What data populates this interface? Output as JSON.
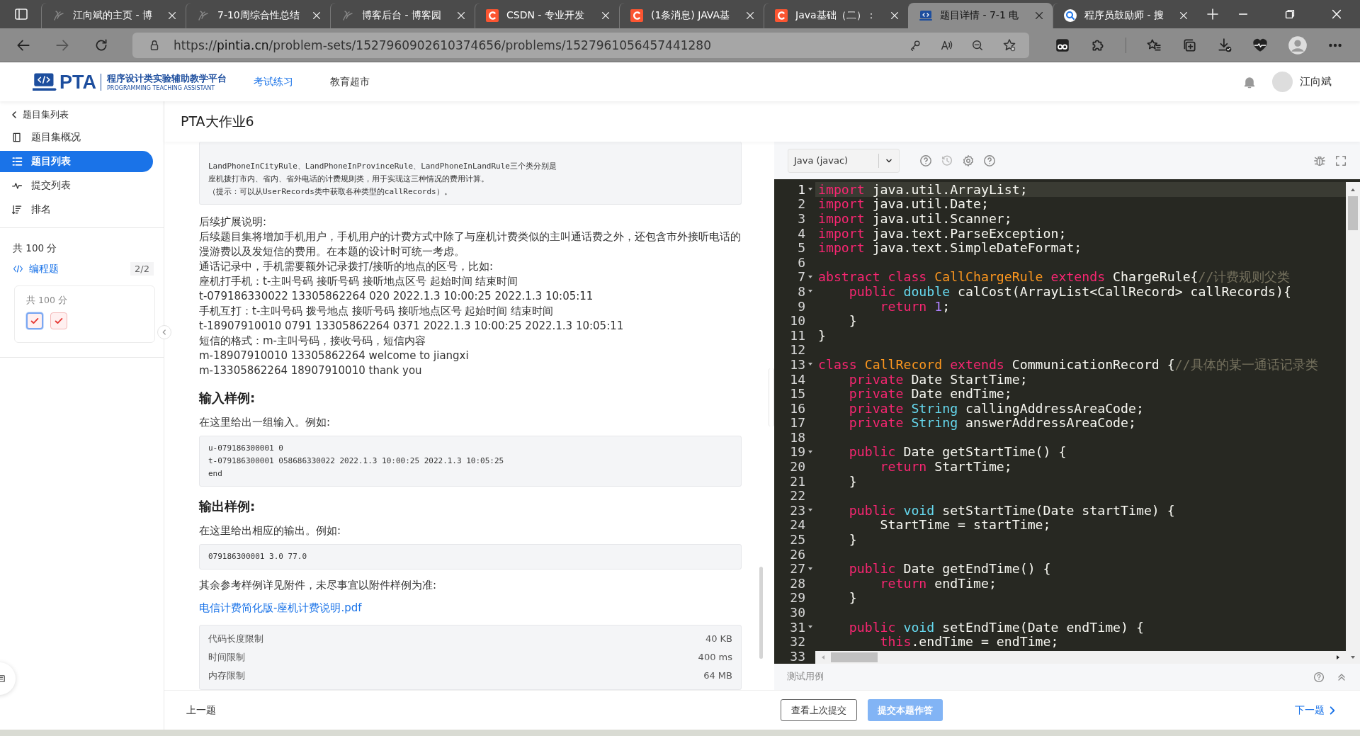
{
  "browser": {
    "tabs": [
      {
        "title": "江向斌的主页 - 博",
        "kind": "blog",
        "selected": false
      },
      {
        "title": "7-10周综合性总结",
        "kind": "blog",
        "selected": false
      },
      {
        "title": "博客后台 - 博客园",
        "kind": "blog",
        "selected": false
      },
      {
        "title": "CSDN - 专业开发",
        "kind": "csdn",
        "selected": false
      },
      {
        "title": "(1条消息) JAVA基",
        "kind": "csdn",
        "selected": false
      },
      {
        "title": "Java基础（二）：",
        "kind": "csdn",
        "selected": false
      },
      {
        "title": "题目详情 - 7-1 电",
        "kind": "pta",
        "selected": true
      },
      {
        "title": "程序员鼓励师 - 搜",
        "kind": "search",
        "selected": false
      }
    ],
    "url_prefix": "https://",
    "url_domain": "pintia.cn",
    "url_path": "/problem-sets/1527960902610374656/problems/1527961056457441280"
  },
  "header": {
    "logo": "PTA",
    "platform": "程序设计类实验辅助教学平台",
    "platform_en": "PROGRAMMING TEACHING ASSISTANT",
    "nav": [
      {
        "label": "考试练习",
        "selected": true
      },
      {
        "label": "教育超市",
        "selected": false
      }
    ],
    "user": "江向斌"
  },
  "sidebar": {
    "back": "题目集列表",
    "items": [
      {
        "label": "题目集概况",
        "kind": "overview",
        "selected": false
      },
      {
        "label": "题目列表",
        "kind": "list",
        "selected": true
      },
      {
        "label": "提交列表",
        "kind": "submissions",
        "selected": false
      },
      {
        "label": "排名",
        "kind": "ranking",
        "selected": false
      }
    ],
    "total": "共 100 分",
    "section": {
      "label": "编程题",
      "count": "2/2"
    },
    "card": {
      "total": "共 100 分",
      "problems": [
        {
          "selected": true,
          "solved": true
        },
        {
          "selected": false,
          "solved": true
        }
      ]
    }
  },
  "problem": {
    "title": "PTA大作业6",
    "blocks": [
      {
        "kind": "code",
        "lines": [
          "LandPhoneInCityRule、LandPhoneInProvinceRule、LandPhoneInLandRule三个类分别是",
          "座机拨打市内、省内、省外电话的计费规则类，用于实现这三种情况的费用计算。",
          "（提示：可以从UserRecords类中获取各种类型的callRecords）。"
        ]
      },
      {
        "kind": "text",
        "lines": [
          "后续扩展说明:",
          "后续题目集将增加手机用户，手机用户的计费方式中除了与座机计费类似的主叫通话费之外，还包含市外接听电话的漫游费以及发短信的费用。在本题的设计时可统一考虑。",
          "通话记录中，手机需要额外记录拨打/接听的地点的区号，比如:",
          "座机打手机：t-主叫号码 接听号码 接听地点区号 起始时间 结束时间",
          "t-079186330022 13305862264 020 2022.1.3 10:00:25 2022.1.3 10:05:11",
          "手机互打：t-主叫号码 拨号地点 接听号码 接听地点区号 起始时间 结束时间",
          "t-18907910010 0791 13305862264 0371 2022.1.3 10:00:25 2022.1.3 10:05:11",
          "短信的格式：m-主叫号码，接收号码，短信内容",
          "m-18907910010 13305862264 welcome to jiangxi",
          "m-13305862264 18907910010 thank you"
        ]
      },
      {
        "kind": "heading",
        "text": "输入样例:"
      },
      {
        "kind": "text",
        "lines": [
          "在这里给出一组输入。例如:"
        ]
      },
      {
        "kind": "code",
        "lines": [
          "u-079186300001 0",
          "t-079186300001 058686330022 2022.1.3 10:00:25 2022.1.3 10:05:25",
          "end"
        ]
      },
      {
        "kind": "heading",
        "text": "输出样例:"
      },
      {
        "kind": "text",
        "lines": [
          "在这里给出相应的输出。例如:"
        ]
      },
      {
        "kind": "code",
        "lines": [
          "079186300001 3.0 77.0"
        ]
      },
      {
        "kind": "text",
        "lines": [
          "其余参考样例详见附件，未尽事宜以附件样例为准:"
        ]
      },
      {
        "kind": "link",
        "text": "电信计费简化版-座机计费说明.pdf"
      },
      {
        "kind": "limits",
        "rows": [
          {
            "label": "代码长度限制",
            "value": "40 KB"
          },
          {
            "label": "时间限制",
            "value": "400 ms"
          },
          {
            "label": "内存限制",
            "value": "64 MB"
          }
        ]
      }
    ]
  },
  "editor": {
    "language": "Java (javac)",
    "lines": [
      {
        "n": "1",
        "fold": true,
        "active": true,
        "tokens": [
          {
            "kind": "kw",
            "text": "import"
          },
          {
            "kind": "pl",
            "text": " java.util.ArrayList;"
          }
        ]
      },
      {
        "n": "2",
        "fold": false,
        "active": false,
        "tokens": [
          {
            "kind": "kw",
            "text": "import"
          },
          {
            "kind": "pl",
            "text": " java.util.Date;"
          }
        ]
      },
      {
        "n": "3",
        "fold": false,
        "active": false,
        "tokens": [
          {
            "kind": "kw",
            "text": "import"
          },
          {
            "kind": "pl",
            "text": " java.util.Scanner;"
          }
        ]
      },
      {
        "n": "4",
        "fold": false,
        "active": false,
        "tokens": [
          {
            "kind": "kw",
            "text": "import"
          },
          {
            "kind": "pl",
            "text": " java.text.ParseException;"
          }
        ]
      },
      {
        "n": "5",
        "fold": false,
        "active": false,
        "tokens": [
          {
            "kind": "kw",
            "text": "import"
          },
          {
            "kind": "pl",
            "text": " java.text.SimpleDateFormat;"
          }
        ]
      },
      {
        "n": "6",
        "fold": false,
        "active": false
      },
      {
        "n": "7",
        "fold": true,
        "active": false,
        "tokens": [
          {
            "kind": "kw",
            "text": "abstract"
          },
          {
            "kind": "kw",
            "text": " class"
          },
          {
            "kind": "cls",
            "text": " CallChargeRule"
          },
          {
            "kind": "kw",
            "text": " extends"
          },
          {
            "kind": "pl",
            "text": " ChargeRule{"
          },
          {
            "kind": "cm",
            "text": "//计费规则父类"
          }
        ]
      },
      {
        "n": "8",
        "fold": true,
        "active": false,
        "tokens": [
          {
            "kind": "kw",
            "text": "    public"
          },
          {
            "kind": "ty",
            "text": " double"
          },
          {
            "kind": "pl",
            "text": " calCost(ArrayList<CallRecord> callRecords){"
          }
        ]
      },
      {
        "n": "9",
        "fold": false,
        "active": false,
        "tokens": [
          {
            "kind": "kw",
            "text": "        return"
          },
          {
            "kind": "num",
            "text": " 1"
          },
          {
            "kind": "pl",
            "text": ";"
          }
        ]
      },
      {
        "n": "10",
        "fold": false,
        "active": false,
        "tokens": [
          {
            "kind": "pl",
            "text": "    }"
          }
        ]
      },
      {
        "n": "11",
        "fold": false,
        "active": false,
        "tokens": [
          {
            "kind": "pl",
            "text": "}"
          }
        ]
      },
      {
        "n": "12",
        "fold": false,
        "active": false
      },
      {
        "n": "13",
        "fold": true,
        "active": false,
        "tokens": [
          {
            "kind": "kw",
            "text": "class"
          },
          {
            "kind": "cls",
            "text": " CallRecord"
          },
          {
            "kind": "kw",
            "text": " extends"
          },
          {
            "kind": "pl",
            "text": " CommunicationRecord {"
          },
          {
            "kind": "cm",
            "text": "//具体的某一通话记录类"
          }
        ]
      },
      {
        "n": "14",
        "fold": false,
        "active": false,
        "tokens": [
          {
            "kind": "kw",
            "text": "    private"
          },
          {
            "kind": "pl",
            "text": " Date StartTime;"
          }
        ]
      },
      {
        "n": "15",
        "fold": false,
        "active": false,
        "tokens": [
          {
            "kind": "kw",
            "text": "    private"
          },
          {
            "kind": "pl",
            "text": " Date endTime;"
          }
        ]
      },
      {
        "n": "16",
        "fold": false,
        "active": false,
        "tokens": [
          {
            "kind": "kw",
            "text": "    private"
          },
          {
            "kind": "ty",
            "text": " String"
          },
          {
            "kind": "pl",
            "text": " callingAddressAreaCode;"
          }
        ]
      },
      {
        "n": "17",
        "fold": false,
        "active": false,
        "tokens": [
          {
            "kind": "kw",
            "text": "    private"
          },
          {
            "kind": "ty",
            "text": " String"
          },
          {
            "kind": "pl",
            "text": " answerAddressAreaCode;"
          }
        ]
      },
      {
        "n": "18",
        "fold": false,
        "active": false
      },
      {
        "n": "19",
        "fold": true,
        "active": false,
        "tokens": [
          {
            "kind": "kw",
            "text": "    public"
          },
          {
            "kind": "pl",
            "text": " Date getStartTime() {"
          }
        ]
      },
      {
        "n": "20",
        "fold": false,
        "active": false,
        "tokens": [
          {
            "kind": "kw",
            "text": "        return"
          },
          {
            "kind": "pl",
            "text": " StartTime;"
          }
        ]
      },
      {
        "n": "21",
        "fold": false,
        "active": false,
        "tokens": [
          {
            "kind": "pl",
            "text": "    }"
          }
        ]
      },
      {
        "n": "22",
        "fold": false,
        "active": false
      },
      {
        "n": "23",
        "fold": true,
        "active": false,
        "tokens": [
          {
            "kind": "kw",
            "text": "    public"
          },
          {
            "kind": "ty",
            "text": " void"
          },
          {
            "kind": "pl",
            "text": " setStartTime(Date startTime) {"
          }
        ]
      },
      {
        "n": "24",
        "fold": false,
        "active": false,
        "tokens": [
          {
            "kind": "pl",
            "text": "        StartTime = startTime;"
          }
        ]
      },
      {
        "n": "25",
        "fold": false,
        "active": false,
        "tokens": [
          {
            "kind": "pl",
            "text": "    }"
          }
        ]
      },
      {
        "n": "26",
        "fold": false,
        "active": false
      },
      {
        "n": "27",
        "fold": true,
        "active": false,
        "tokens": [
          {
            "kind": "kw",
            "text": "    public"
          },
          {
            "kind": "pl",
            "text": " Date getEndTime() {"
          }
        ]
      },
      {
        "n": "28",
        "fold": false,
        "active": false,
        "tokens": [
          {
            "kind": "kw",
            "text": "        return"
          },
          {
            "kind": "pl",
            "text": " endTime;"
          }
        ]
      },
      {
        "n": "29",
        "fold": false,
        "active": false,
        "tokens": [
          {
            "kind": "pl",
            "text": "    }"
          }
        ]
      },
      {
        "n": "30",
        "fold": false,
        "active": false
      },
      {
        "n": "31",
        "fold": true,
        "active": false,
        "tokens": [
          {
            "kind": "kw",
            "text": "    public"
          },
          {
            "kind": "ty",
            "text": " void"
          },
          {
            "kind": "pl",
            "text": " setEndTime(Date endTime) {"
          }
        ]
      },
      {
        "n": "32",
        "fold": false,
        "active": false,
        "tokens": [
          {
            "kind": "kw",
            "text": "        this"
          },
          {
            "kind": "pl",
            "text": ".endTime = endTime;"
          }
        ]
      },
      {
        "n": "33",
        "fold": false,
        "active": false
      }
    ],
    "testcase": "测试用例"
  },
  "footer": {
    "prev": "上一题",
    "last_submission": "查看上次提交",
    "submit": "提交本题作答",
    "next": "下一题"
  }
}
